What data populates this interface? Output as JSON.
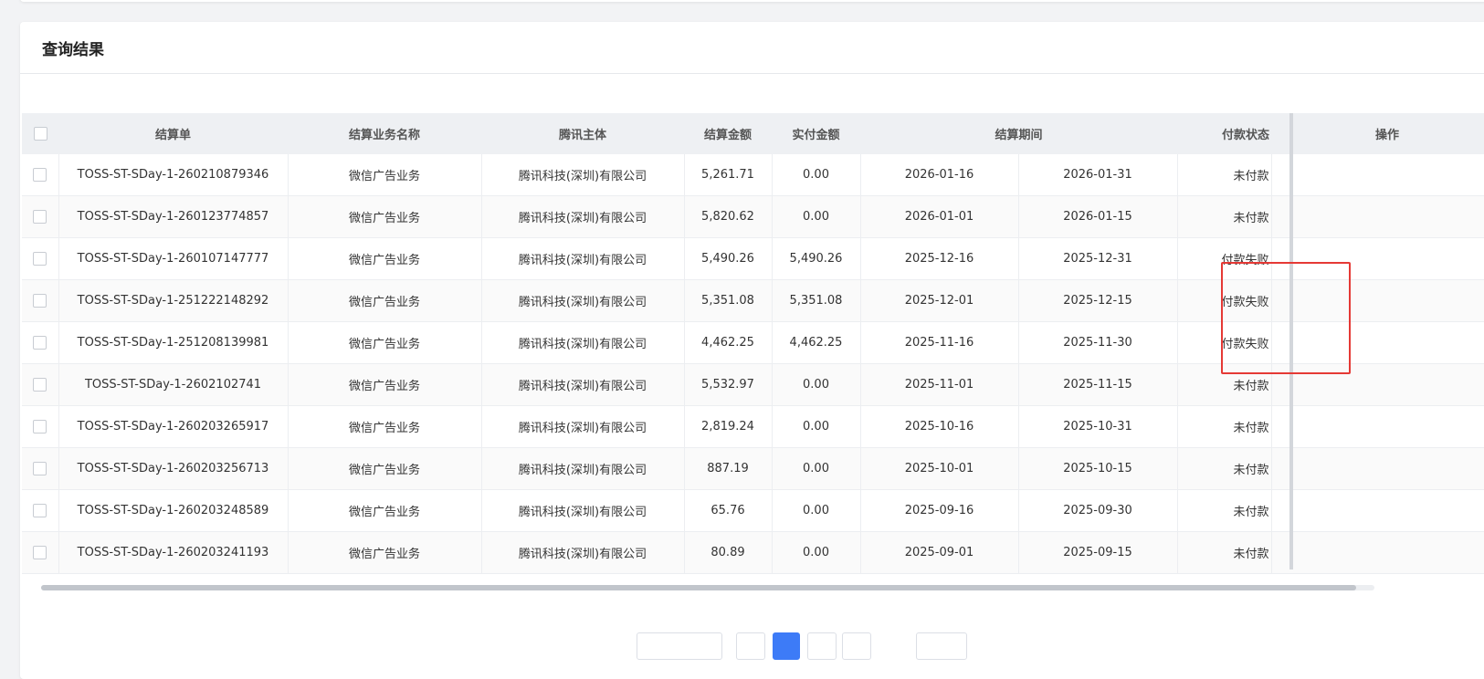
{
  "panel": {
    "title": "查询结果"
  },
  "table": {
    "columns": [
      "结算单",
      "结算业务名称",
      "腾讯主体",
      "结算金额",
      "实付金额",
      "结算期间",
      "付款状态",
      "操作"
    ],
    "rows": [
      {
        "id": "TOSS-ST-SDay-1-260210879346",
        "biz": "微信广告业务",
        "entity": "腾讯科技(深圳)有限公司",
        "amount": "5,261.71",
        "paid": "0.00",
        "from": "2026-01-16",
        "to": "2026-01-31",
        "status": "未付款"
      },
      {
        "id": "TOSS-ST-SDay-1-260123774857",
        "biz": "微信广告业务",
        "entity": "腾讯科技(深圳)有限公司",
        "amount": "5,820.62",
        "paid": "0.00",
        "from": "2026-01-01",
        "to": "2026-01-15",
        "status": "未付款"
      },
      {
        "id": "TOSS-ST-SDay-1-260107147777",
        "biz": "微信广告业务",
        "entity": "腾讯科技(深圳)有限公司",
        "amount": "5,490.26",
        "paid": "5,490.26",
        "from": "2025-12-16",
        "to": "2025-12-31",
        "status": "付款失败"
      },
      {
        "id": "TOSS-ST-SDay-1-251222148292",
        "biz": "微信广告业务",
        "entity": "腾讯科技(深圳)有限公司",
        "amount": "5,351.08",
        "paid": "5,351.08",
        "from": "2025-12-01",
        "to": "2025-12-15",
        "status": "付款失败"
      },
      {
        "id": "TOSS-ST-SDay-1-251208139981",
        "biz": "微信广告业务",
        "entity": "腾讯科技(深圳)有限公司",
        "amount": "4,462.25",
        "paid": "4,462.25",
        "from": "2025-11-16",
        "to": "2025-11-30",
        "status": "付款失败"
      },
      {
        "id": "TOSS-ST-SDay-1-2602102741",
        "biz": "微信广告业务",
        "entity": "腾讯科技(深圳)有限公司",
        "amount": "5,532.97",
        "paid": "0.00",
        "from": "2025-11-01",
        "to": "2025-11-15",
        "status": "未付款"
      },
      {
        "id": "TOSS-ST-SDay-1-260203265917",
        "biz": "微信广告业务",
        "entity": "腾讯科技(深圳)有限公司",
        "amount": "2,819.24",
        "paid": "0.00",
        "from": "2025-10-16",
        "to": "2025-10-31",
        "status": "未付款"
      },
      {
        "id": "TOSS-ST-SDay-1-260203256713",
        "biz": "微信广告业务",
        "entity": "腾讯科技(深圳)有限公司",
        "amount": "887.19",
        "paid": "0.00",
        "from": "2025-10-01",
        "to": "2025-10-15",
        "status": "未付款"
      },
      {
        "id": "TOSS-ST-SDay-1-260203248589",
        "biz": "微信广告业务",
        "entity": "腾讯科技(深圳)有限公司",
        "amount": "65.76",
        "paid": "0.00",
        "from": "2025-09-16",
        "to": "2025-09-30",
        "status": "未付款"
      },
      {
        "id": "TOSS-ST-SDay-1-260203241193",
        "biz": "微信广告业务",
        "entity": "腾讯科技(深圳)有限公司",
        "amount": "80.89",
        "paid": "0.00",
        "from": "2025-09-01",
        "to": "2025-09-15",
        "status": "未付款"
      }
    ]
  },
  "colors": {
    "highlight": "#e53935",
    "pager_active": "#3d7bf7",
    "header_bg": "#eef0f3"
  }
}
